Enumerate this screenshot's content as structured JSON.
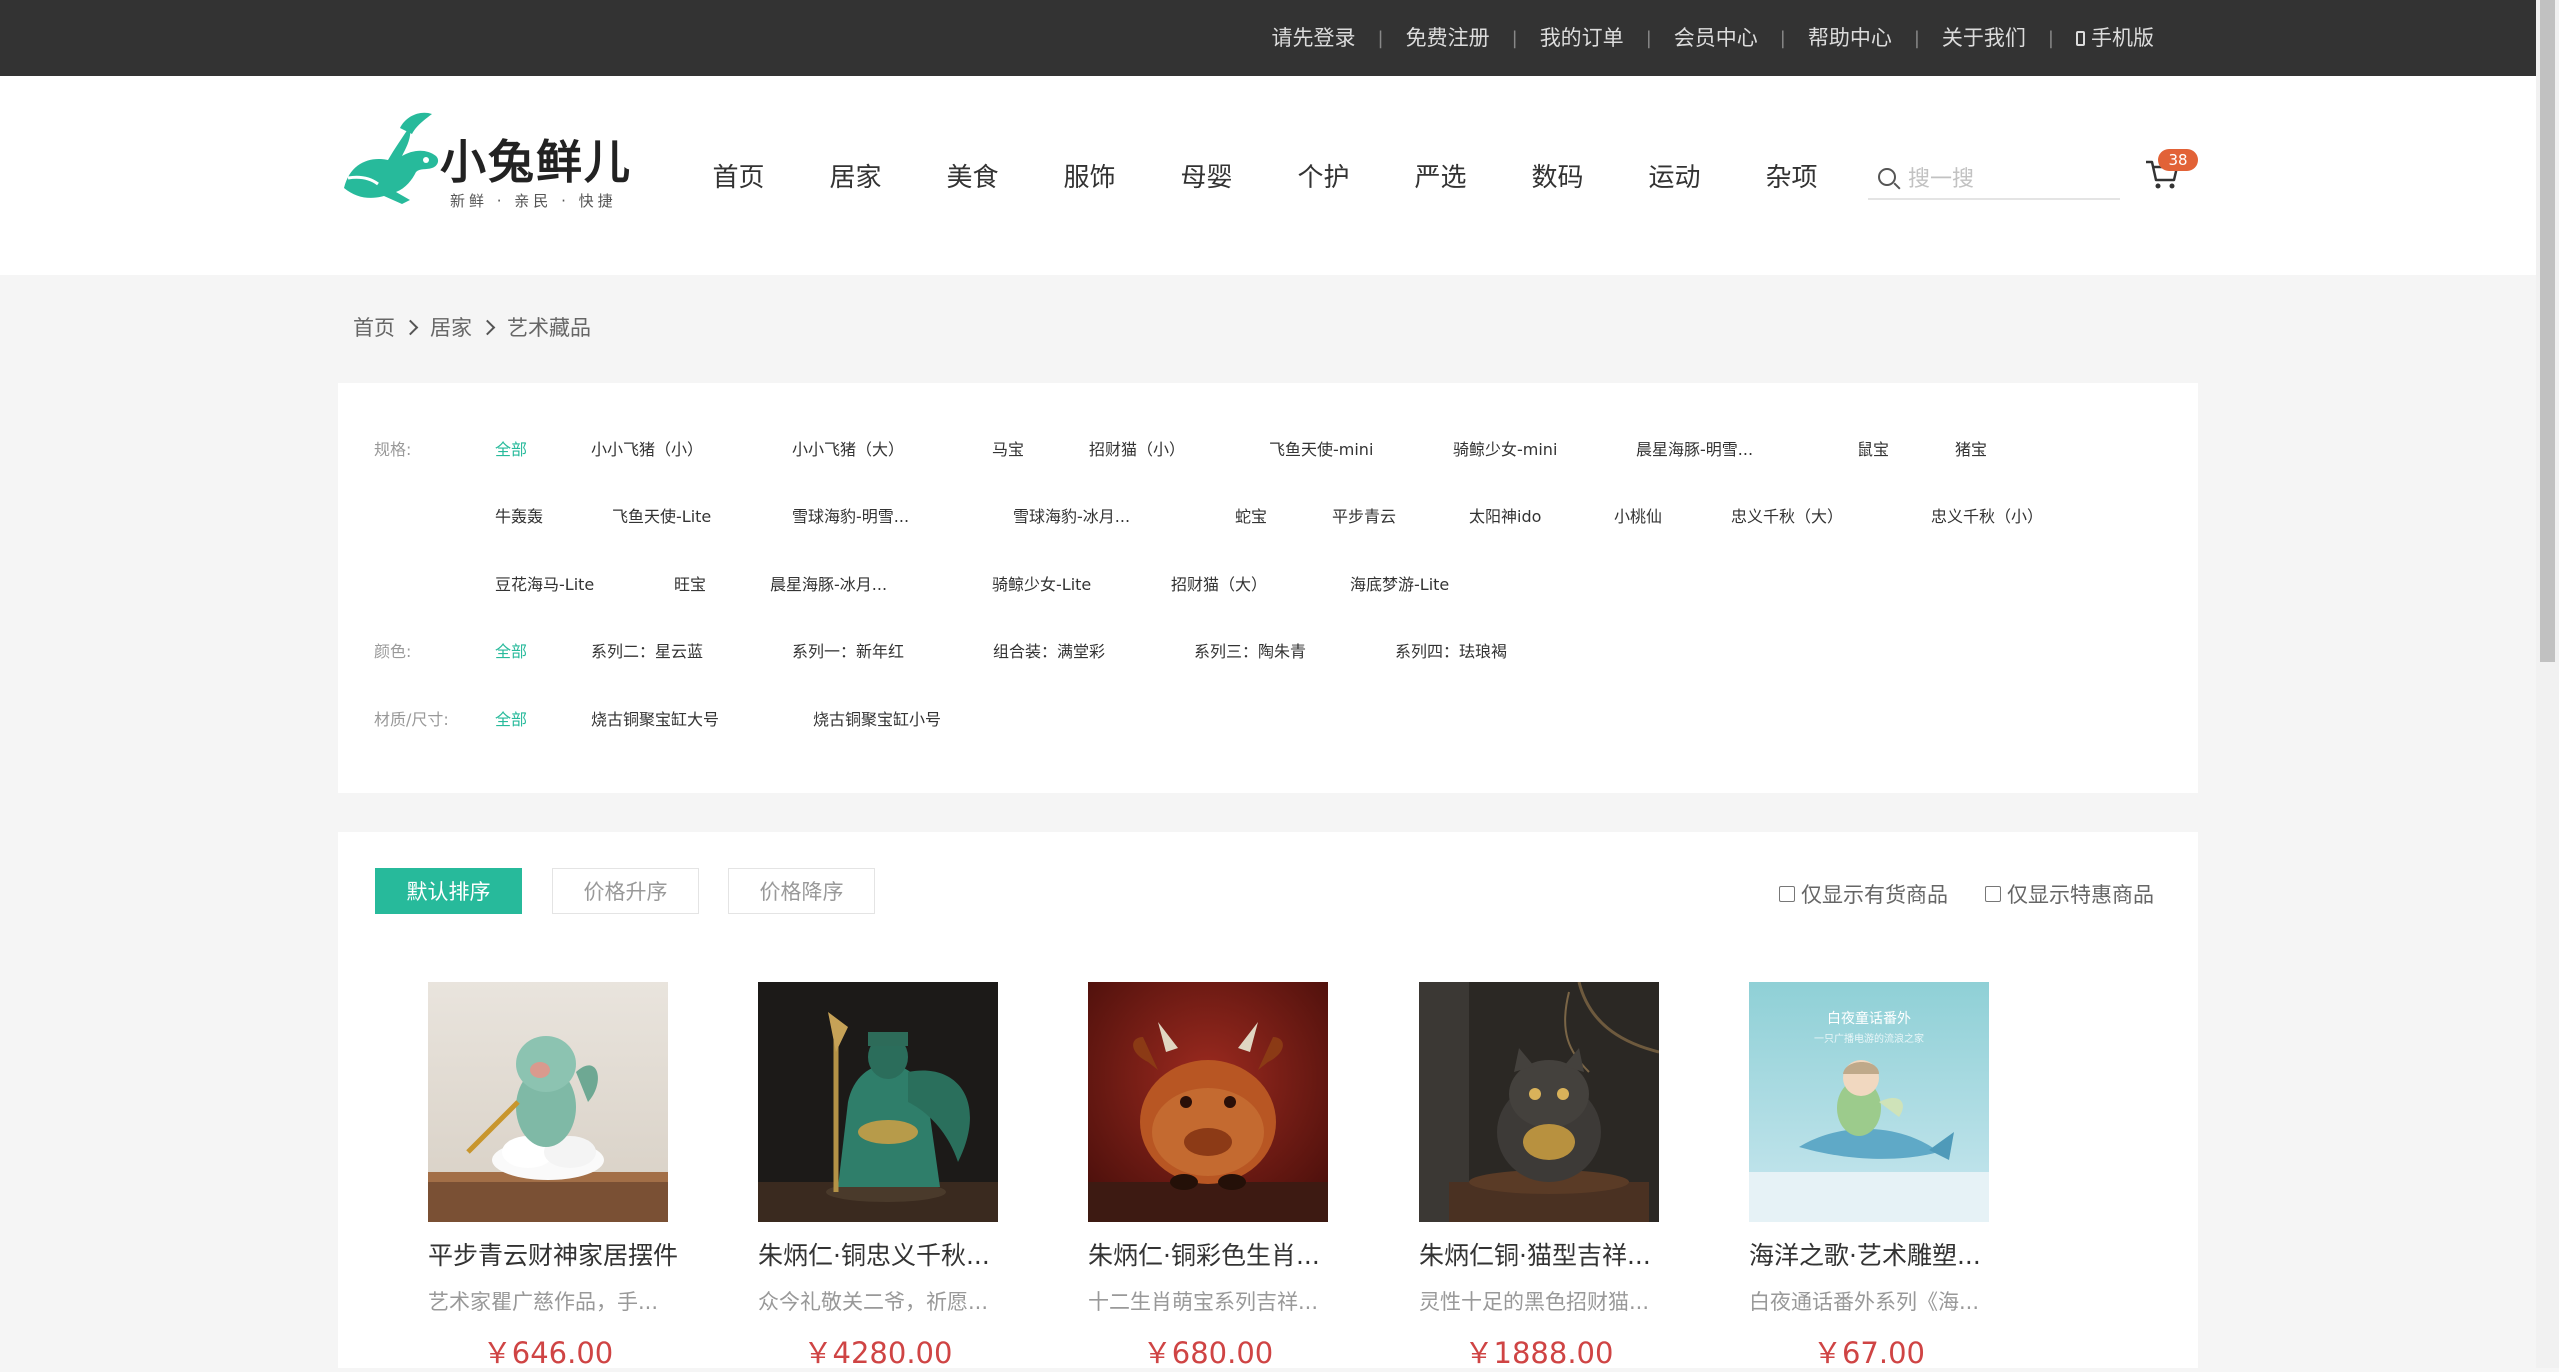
{
  "topbar": {
    "links": [
      "请先登录",
      "免费注册",
      "我的订单",
      "会员中心",
      "帮助中心",
      "关于我们"
    ],
    "mobile": "手机版"
  },
  "header": {
    "logo_text": "小兔鲜儿",
    "logo_sub": "新鲜 · 亲民 · 快捷",
    "nav": [
      "首页",
      "居家",
      "美食",
      "服饰",
      "母婴",
      "个护",
      "严选",
      "数码",
      "运动",
      "杂项"
    ],
    "search_placeholder": "搜一搜",
    "cart_count": "38",
    "brand_color": "#27ba9b"
  },
  "breadcrumb": [
    "首页",
    "居家",
    "艺术藏品"
  ],
  "filters": {
    "spec_label": "规格:",
    "spec_options": [
      "全部",
      "小小飞猪（小）",
      "小小飞猪（大）",
      "马宝",
      "招财猫（小）",
      "飞鱼天使-mini",
      "骑鲸少女-mini",
      "晨星海豚-明雪...",
      "鼠宝",
      "猪宝",
      "牛轰轰",
      "飞鱼天使-Lite",
      "雪球海豹-明雪...",
      "雪球海豹-冰月...",
      "蛇宝",
      "平步青云",
      "太阳神ido",
      "小桃仙",
      "忠义千秋（大）",
      "忠义千秋（小）",
      "豆花海马-Lite",
      "旺宝",
      "晨星海豚-冰月...",
      "骑鲸少女-Lite",
      "招财猫（大）",
      "海底梦游-Lite"
    ],
    "color_label": "颜色:",
    "color_options": [
      "全部",
      "系列二：星云蓝",
      "系列一：新年红",
      "组合装：满堂彩",
      "系列三：陶朱青",
      "系列四：珐琅褐"
    ],
    "size_label": "材质/尺寸:",
    "size_options": [
      "全部",
      "烧古铜聚宝缸大号",
      "烧古铜聚宝缸小号"
    ]
  },
  "sort": {
    "buttons": [
      "默认排序",
      "价格升序",
      "价格降序"
    ],
    "in_stock": "仅显示有货商品",
    "discount": "仅显示特惠商品"
  },
  "products": [
    {
      "name": "平步青云财神家居摆件",
      "desc": "艺术家瞿广慈作品，手...",
      "price": "￥646.00"
    },
    {
      "name": "朱炳仁·铜忠义千秋...",
      "desc": "众今礼敬关二爷，祈愿...",
      "price": "￥4280.00"
    },
    {
      "name": "朱炳仁·铜彩色生肖...",
      "desc": "十二生肖萌宝系列吉祥...",
      "price": "￥680.00"
    },
    {
      "name": "朱炳仁铜·猫型吉祥...",
      "desc": "灵性十足的黑色招财猫...",
      "price": "￥1888.00"
    },
    {
      "name": "海洋之歌·艺术雕塑...",
      "desc": "白夜通话番外系列《海...",
      "price": "￥67.00"
    }
  ],
  "poster_text": {
    "title": "白夜童话番外",
    "sub": "一只广播电游的流浪之家"
  }
}
